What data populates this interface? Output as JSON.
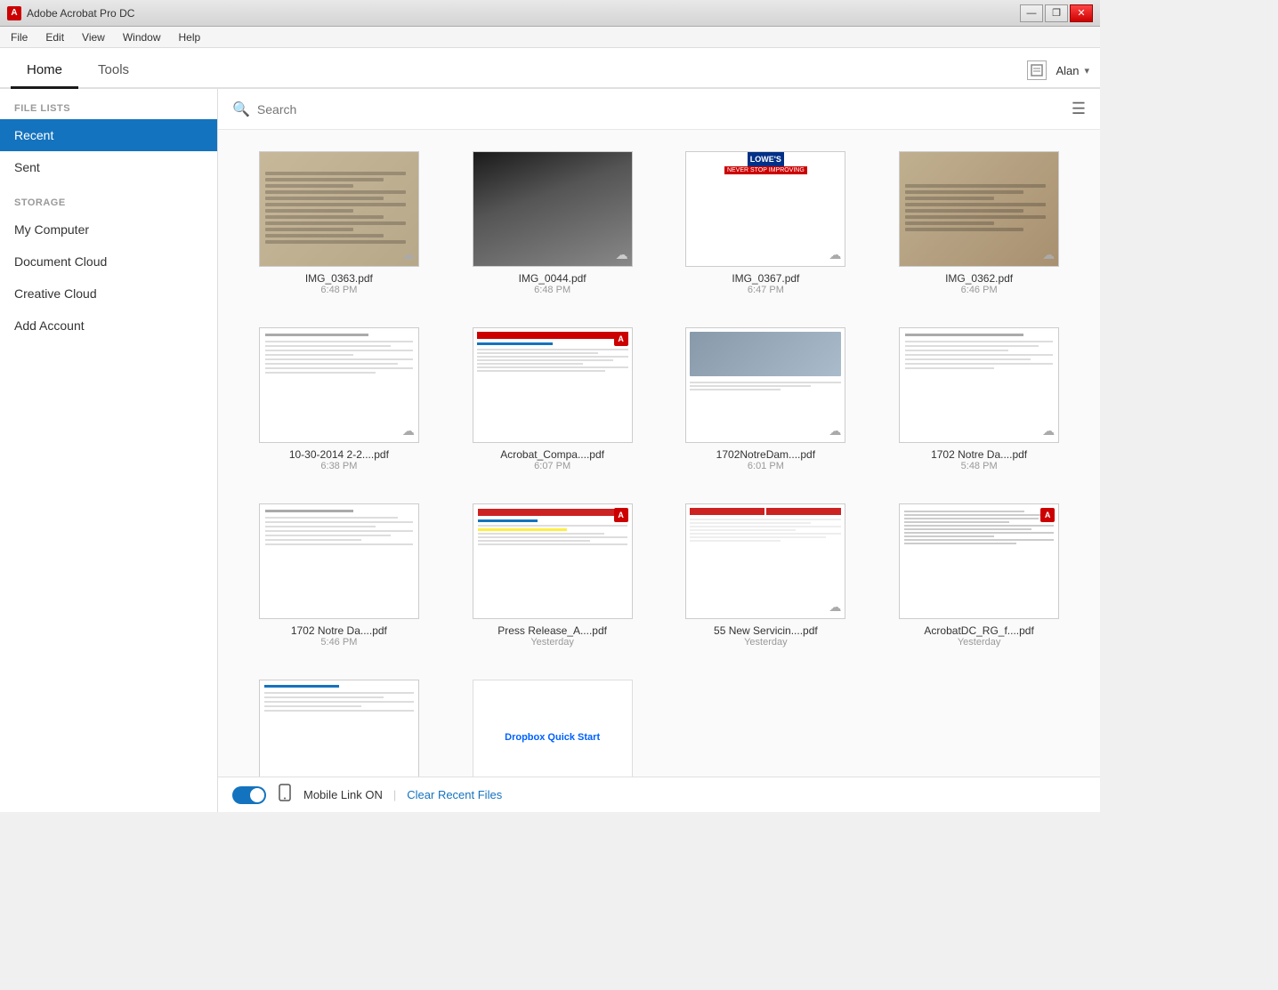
{
  "app": {
    "title": "Adobe Acrobat Pro DC",
    "icon_label": "A"
  },
  "menu": {
    "items": [
      "File",
      "Edit",
      "View",
      "Window",
      "Help"
    ]
  },
  "tabs": {
    "items": [
      {
        "label": "Home",
        "active": true
      },
      {
        "label": "Tools",
        "active": false
      }
    ]
  },
  "user": {
    "name": "Alan",
    "chevron": "▾"
  },
  "sidebar": {
    "file_lists_label": "FILE LISTS",
    "items_file": [
      {
        "label": "Recent",
        "active": true
      },
      {
        "label": "Sent",
        "active": false
      }
    ],
    "storage_label": "STORAGE",
    "items_storage": [
      {
        "label": "My Computer",
        "active": false
      },
      {
        "label": "Document Cloud",
        "active": false
      },
      {
        "label": "Creative Cloud",
        "active": false
      },
      {
        "label": "Add Account",
        "active": false
      }
    ]
  },
  "search": {
    "placeholder": "Search"
  },
  "files": [
    {
      "name": "IMG_0363.pdf",
      "time": "6:48 PM",
      "type": "receipt",
      "cloud": true
    },
    {
      "name": "IMG_0044.pdf",
      "time": "6:48 PM",
      "type": "dark_paper",
      "cloud": true
    },
    {
      "name": "IMG_0367.pdf",
      "time": "6:47 PM",
      "type": "lowes",
      "cloud": true
    },
    {
      "name": "IMG_0362.pdf",
      "time": "6:46 PM",
      "type": "receipt2",
      "cloud": true
    },
    {
      "name": "10-30-2014 2-2....pdf",
      "time": "6:38 PM",
      "type": "form",
      "cloud": true
    },
    {
      "name": "Acrobat_Compa....pdf",
      "time": "6:07 PM",
      "type": "acrobat_doc",
      "cloud": false,
      "adobe": true
    },
    {
      "name": "1702NotreDam....pdf",
      "time": "6:01 PM",
      "type": "photo_doc",
      "cloud": true
    },
    {
      "name": "1702 Notre Da....pdf",
      "time": "5:48 PM",
      "type": "text_doc",
      "cloud": true
    },
    {
      "name": "1702 Notre Da....pdf",
      "time": "5:46 PM",
      "type": "text_doc2",
      "cloud": false
    },
    {
      "name": "Press Release_A....pdf",
      "time": "Yesterday",
      "type": "letter",
      "cloud": false,
      "adobe": true
    },
    {
      "name": "55 New Servicin....pdf",
      "time": "Yesterday",
      "type": "report",
      "cloud": true
    },
    {
      "name": "AcrobatDC_RG_f....pdf",
      "time": "Yesterday",
      "type": "text_small",
      "cloud": false,
      "adobe": true
    },
    {
      "name": "",
      "time": "",
      "type": "doc_partial",
      "cloud": false
    },
    {
      "name": "Dropbox Quick Start",
      "time": "",
      "type": "dropbox",
      "cloud": false
    }
  ],
  "bottom": {
    "mobile_label": "Mobile Link ON",
    "separator": "|",
    "clear_label": "Clear Recent Files"
  },
  "window_controls": {
    "minimize": "—",
    "restore": "❐",
    "close": "✕"
  }
}
